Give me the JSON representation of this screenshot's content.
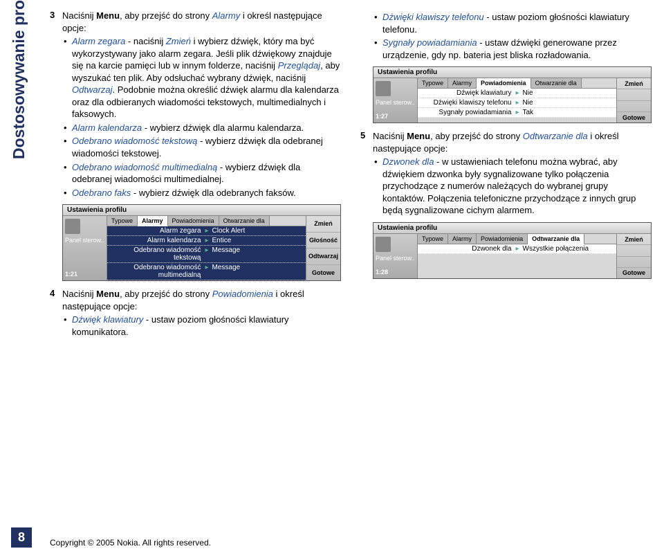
{
  "sidebar": {
    "title": "Dostosowywanie profili",
    "page": "8"
  },
  "left": {
    "step3": {
      "num": "3",
      "intro_a": "Naciśnij ",
      "menu": "Menu",
      "intro_b": ", aby przejść do strony ",
      "alarmy": "Alarmy",
      "intro_c": " i określ następujące opcje:",
      "b1_a": "Alarm zegara",
      "b1_b": " - naciśnij ",
      "b1_c": "Zmień",
      "b1_d": " i wybierz dźwięk, który ma być wykorzystywany jako alarm zegara. Jeśli plik dźwiękowy znajduje się na karcie pamięci lub w innym folderze, naciśnij ",
      "b1_e": "Przeglądaj",
      "b1_f": ", aby wyszukać ten plik. Aby odsłuchać wybrany dźwięk, naciśnij ",
      "b1_g": "Odtwarzaj",
      "b1_h": ". Podobnie można określić dźwięk alarmu dla kalendarza oraz dla odbieranych wiadomości tekstowych, multimedialnych i faksowych.",
      "b2_a": "Alarm kalendarza",
      "b2_b": " - wybierz dźwięk dla alarmu kalendarza.",
      "b3_a": "Odebrano wiadomość tekstową",
      "b3_b": " - wybierz dźwięk dla odebranej wiadomości tekstowej.",
      "b4_a": "Odebrano wiadomość multimedialną",
      "b4_b": " - wybierz dźwięk dla odebranej wiadomości multimedialnej.",
      "b5_a": "Odebrano faks",
      "b5_b": " - wybierz dźwięk dla odebranych faksów."
    },
    "screen1": {
      "title": "Ustawienia profilu",
      "panel": "Panel sterow..",
      "time": "1:21",
      "tabs": [
        "Typowe",
        "Alarmy",
        "Powiadomienia",
        "Otwarzanie dla"
      ],
      "active_tab": 1,
      "rows": [
        {
          "lbl": "Alarm zegara",
          "val": "Clock Alert",
          "dark": true
        },
        {
          "lbl": "Alarm kalendarza",
          "val": "Entice",
          "dark": true
        },
        {
          "lbl": "Odebrano wiadomość tekstową",
          "val": "Message",
          "dark": true
        },
        {
          "lbl": "Odebrano wiadomość multimedialną",
          "val": "Message",
          "dark": true
        }
      ],
      "softkeys": [
        "Zmień",
        "Głośność",
        "Odtwarzaj",
        "Gotowe"
      ]
    },
    "step4": {
      "num": "4",
      "intro_a": "Naciśnij ",
      "menu": "Menu",
      "intro_b": ", aby przejść do strony ",
      "pow": "Powiadomienia",
      "intro_c": " i określ następujące opcje:",
      "b1_a": "Dźwięk klawiatury",
      "b1_b": " - ustaw poziom głośności klawiatury komunikatora."
    }
  },
  "right": {
    "bullets": {
      "b1_a": "Dźwięki klawiszy telefonu",
      "b1_b": " - ustaw poziom głośności klawiatury telefonu.",
      "b2_a": "Sygnały powiadamiania",
      "b2_b": " - ustaw dźwięki generowane przez urządzenie, gdy np. bateria jest bliska rozładowania."
    },
    "screen2": {
      "title": "Ustawienia profilu",
      "panel": "Panel sterow..",
      "time": "1:27",
      "tabs": [
        "Typowe",
        "Alarmy",
        "Powiadomienia",
        "Otwarzanie dla"
      ],
      "active_tab": 2,
      "rows": [
        {
          "lbl": "Dźwięk klawiatury",
          "val": "Nie",
          "dark": false
        },
        {
          "lbl": "Dźwięki klawiszy telefonu",
          "val": "Nie",
          "dark": false
        },
        {
          "lbl": "Sygnały powiadamiania",
          "val": "Tak",
          "dark": false
        }
      ],
      "softkeys": [
        "Zmień",
        "",
        "",
        "Gotowe"
      ]
    },
    "step5": {
      "num": "5",
      "intro_a": "Naciśnij ",
      "menu": "Menu",
      "intro_b": ", aby przejść do strony ",
      "odt": "Odtwarzanie dla",
      "intro_c": " i określ następujące opcje:",
      "b1_a": "Dzwonek dla",
      "b1_b": " - w ustawieniach telefonu można wybrać, aby dźwiękiem dzwonka były sygnalizowane tylko połączenia przychodzące z numerów należących do wybranej grupy kontaktów. Połączenia telefoniczne przychodzące z innych grup będą sygnalizowane cichym alarmem."
    },
    "screen3": {
      "title": "Ustawienia profilu",
      "panel": "Panel sterow..",
      "time": "1:28",
      "tabs": [
        "Typowe",
        "Alarmy",
        "Powiadomienia",
        "Odtwarzanie dla"
      ],
      "active_tab": 3,
      "rows": [
        {
          "lbl": "Dzwonek dla",
          "val": "Wszystkie połączenia",
          "dark": false
        }
      ],
      "softkeys": [
        "Zmień",
        "",
        "",
        "Gotowe"
      ]
    }
  },
  "footer": {
    "copy_a": "Copyright ",
    "copy_b": "©",
    "copy_c": " 2005 Nokia. All rights reserved."
  }
}
